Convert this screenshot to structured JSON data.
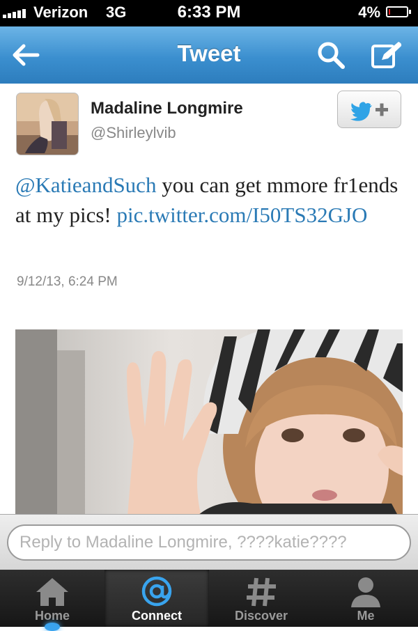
{
  "status_bar": {
    "carrier": "Verizon",
    "network": "3G",
    "time": "6:33 PM",
    "battery_percent": "4%",
    "battery_level": 0.04,
    "battery_color": "#e02020"
  },
  "nav": {
    "title": "Tweet",
    "back_icon": "back-arrow-icon",
    "search_icon": "search-icon",
    "compose_icon": "compose-icon",
    "bar_color": "#3b8fcf"
  },
  "tweet": {
    "author_name": "Madaline Longmire",
    "author_handle": "@Shirleylvib",
    "follow_icon": "twitter-bird-plus-icon",
    "mention": "@KatieandSuch",
    "text": " you can get mmore fr1ends at my pics! ",
    "link": "pic.twitter.com/I50TS32GJO",
    "timestamp": "9/12/13, 6:24 PM",
    "link_color": "#2a7ab5"
  },
  "reply": {
    "placeholder": "Reply to Madaline Longmire, ????katie????"
  },
  "tabs": [
    {
      "label": "Home",
      "icon": "home-icon",
      "active": false
    },
    {
      "label": "Connect",
      "icon": "at-sign-icon",
      "active": true
    },
    {
      "label": "Discover",
      "icon": "hash-icon",
      "active": false
    },
    {
      "label": "Me",
      "icon": "person-icon",
      "active": false
    }
  ]
}
